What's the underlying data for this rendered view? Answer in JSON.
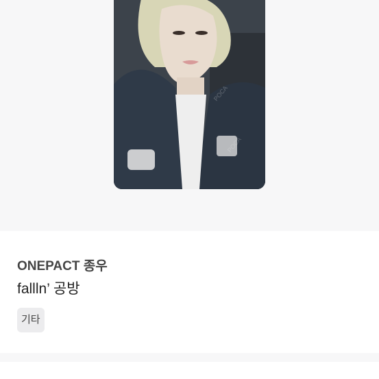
{
  "product": {
    "artist": "ONEPACT 종우",
    "title": "fallln’ 공방",
    "category_tag": "기타"
  },
  "photo": {
    "description_icon": "photocard-image",
    "watermark": "POCA"
  }
}
